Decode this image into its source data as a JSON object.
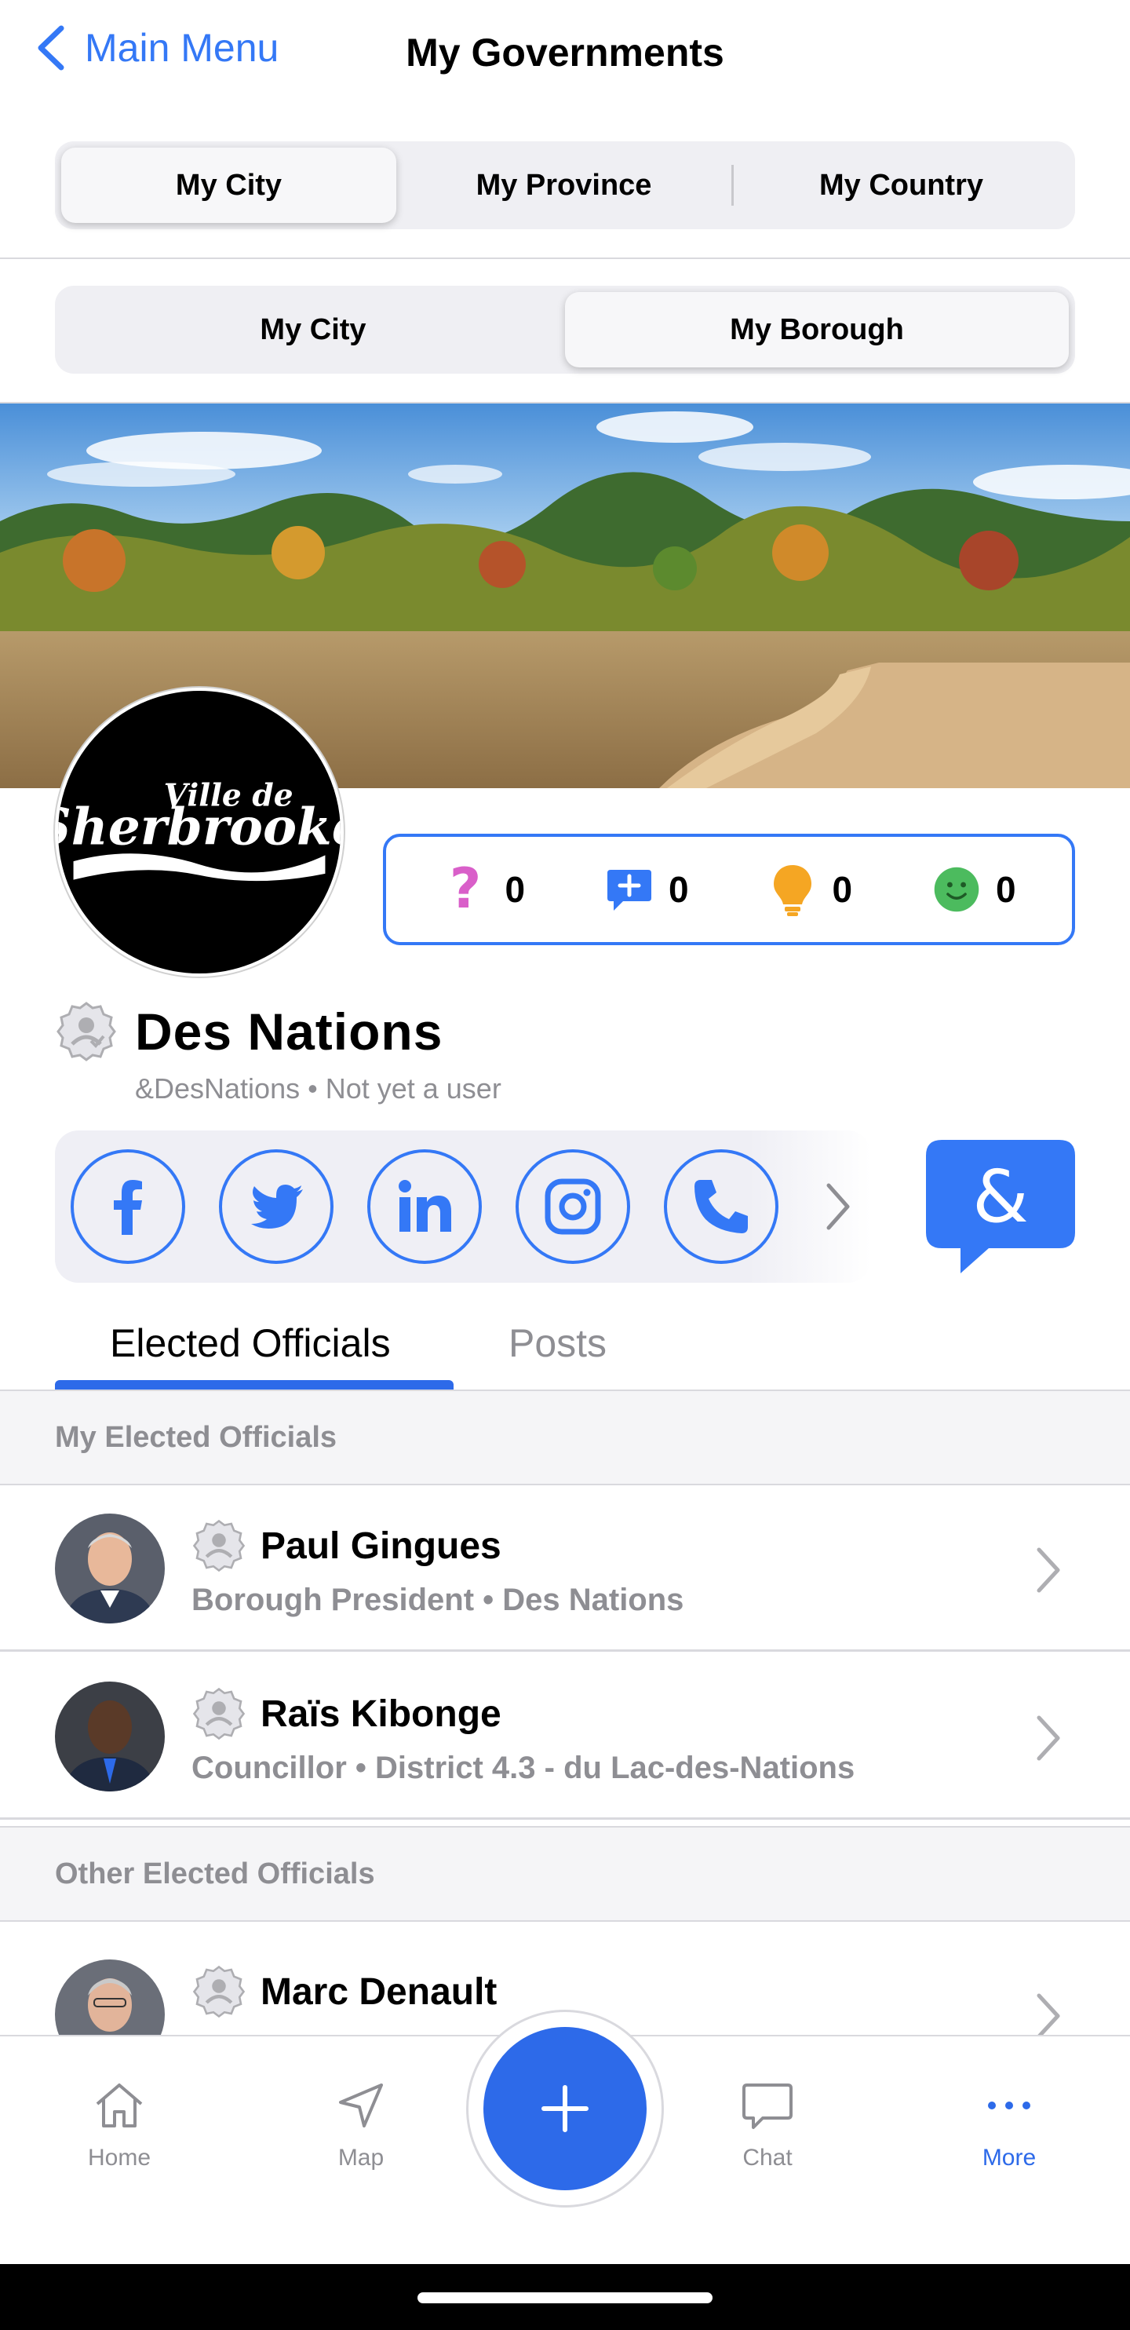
{
  "header": {
    "back_label": "Main Menu",
    "title": "My Governments"
  },
  "gov_tabs": {
    "city": "My City",
    "province": "My Province",
    "country": "My Country",
    "selected": "My City"
  },
  "level_tabs": {
    "city": "My City",
    "borough": "My Borough",
    "selected": "My Borough"
  },
  "logo": {
    "line1": "Ville de",
    "line2": "Sherbrooke"
  },
  "stats": {
    "questions": "0",
    "proposals": "0",
    "ideas": "0",
    "satisfaction": "0"
  },
  "profile": {
    "name": "Des Nations",
    "handle": "&DesNations • Not yet a user"
  },
  "social": [
    "facebook-icon",
    "twitter-icon",
    "linkedin-icon",
    "instagram-icon",
    "phone-icon"
  ],
  "content_tabs": {
    "officials": "Elected Officials",
    "posts": "Posts",
    "selected": "Elected Officials"
  },
  "sections": {
    "my_officials": "My Elected Officials",
    "other_officials": "Other Elected Officials"
  },
  "officials": [
    {
      "name": "Paul Gingues",
      "subtitle": "Borough President • Des Nations"
    },
    {
      "name": "Raïs Kibonge",
      "subtitle": "Councillor • District 4.3 - du Lac-des-Nations"
    },
    {
      "name": "Marc Denault",
      "subtitle": ""
    }
  ],
  "tabbar": {
    "home": "Home",
    "map": "Map",
    "chat": "Chat",
    "more": "More",
    "selected": "More"
  },
  "colors": {
    "accent": "#3478F6",
    "question": "#D95FC9",
    "idea": "#F5A623",
    "happy": "#4CBB5E"
  }
}
